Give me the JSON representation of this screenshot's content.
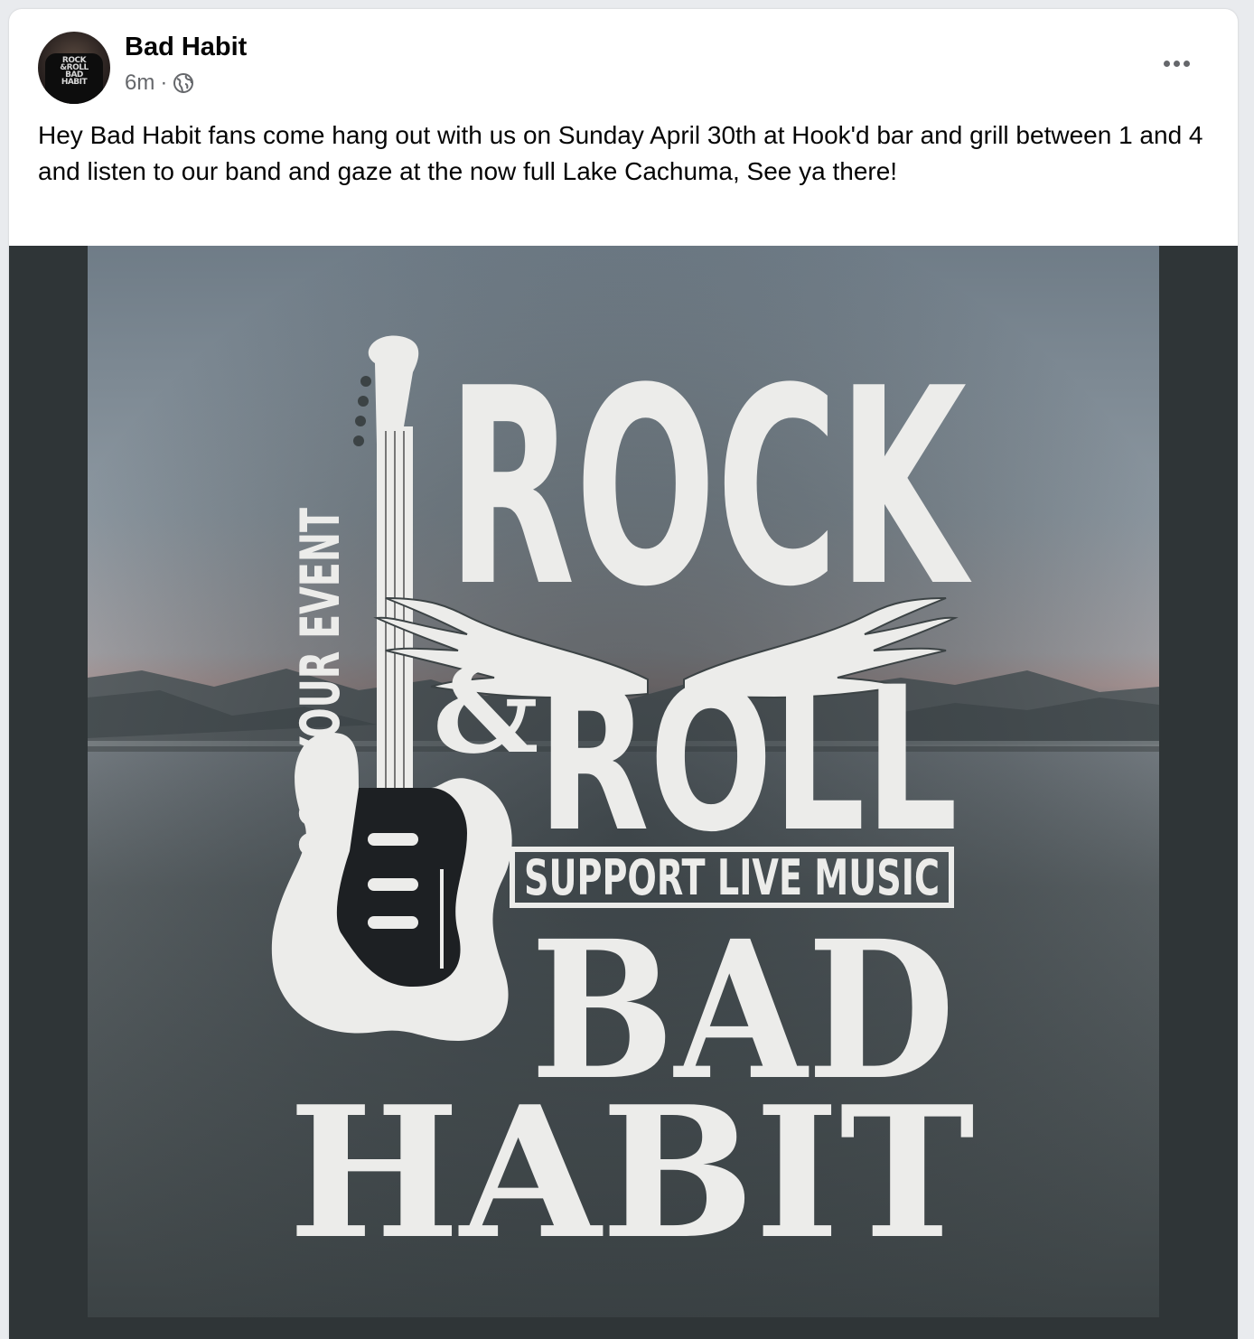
{
  "post": {
    "author": "Bad Habit",
    "time": "6m",
    "separator": "·",
    "privacy_icon": "globe-icon",
    "more_icon": "more-options-icon",
    "text": "Hey Bad Habit fans come hang out with us on Sunday April 30th at Hook'd bar and grill between 1 and 4 and listen to our band and gaze at the now full Lake Cachuma, See ya there!"
  },
  "avatar": {
    "shirt_line1": "ROCK",
    "shirt_line2": "&ROLL",
    "shirt_line3": "BAD",
    "shirt_line4": "HABIT"
  },
  "poster": {
    "side_text": "ROCK YOUR EVENT",
    "word_rock": "ROCK",
    "ampersand": "&",
    "word_roll": "ROLL",
    "banner": "SUPPORT LIVE MUSIC",
    "word_bad": "BAD",
    "word_habit": "HABIT"
  },
  "colors": {
    "card_bg": "#ffffff",
    "secondary_text": "#65676b",
    "media_frame": "#2f3537",
    "poster_text": "#e9e9e6"
  }
}
